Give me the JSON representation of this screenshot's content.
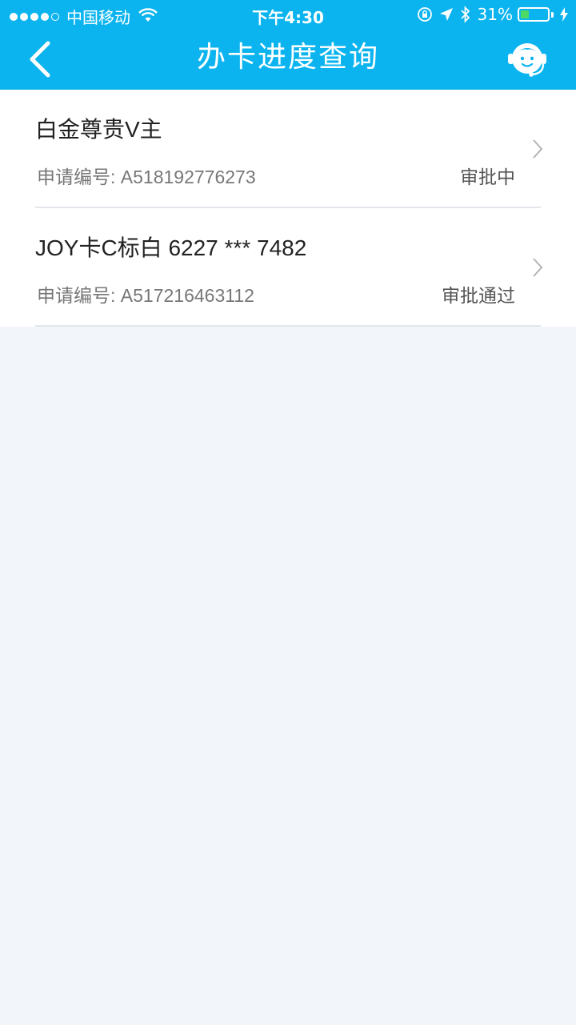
{
  "status_bar": {
    "carrier": "中国移动",
    "time": "下午4:30",
    "battery": "31%",
    "battery_level": 0.31
  },
  "nav": {
    "title": "办卡进度查询",
    "back_icon": "chevron-left-icon",
    "service_icon": "customer-service-icon"
  },
  "applications": [
    {
      "card_name": "白金尊贵V主",
      "app_label": "申请编号: A518192776273",
      "status": "审批中"
    },
    {
      "card_name": "JOY卡C标白 6227 *** 7482",
      "app_label": "申请编号: A517216463112",
      "status": "审批通过"
    }
  ],
  "colors": {
    "accent": "#0bb4ef",
    "background": "#f2f6fa",
    "battery_green": "#4cd964"
  }
}
